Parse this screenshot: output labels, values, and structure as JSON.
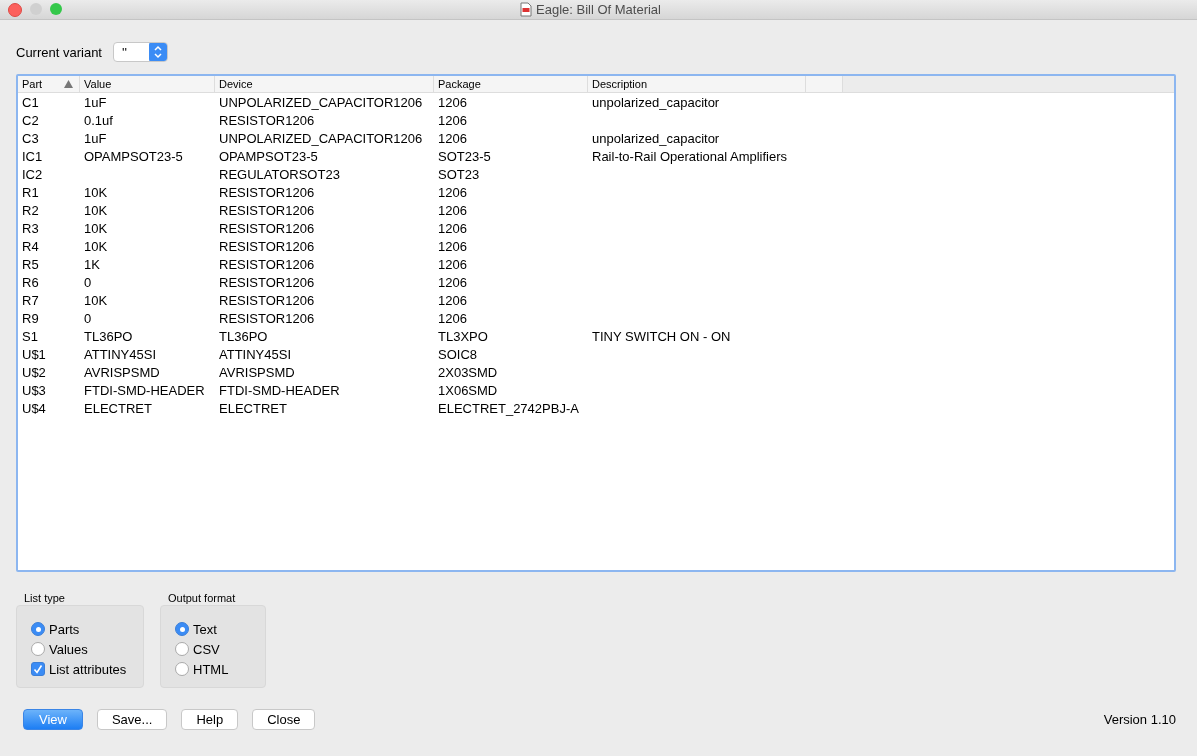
{
  "window": {
    "title": "Eagle: Bill Of Material"
  },
  "variant": {
    "label": "Current variant",
    "value": "''"
  },
  "table": {
    "columns": [
      {
        "label": "Part",
        "sorted": true
      },
      {
        "label": "Value",
        "sorted": false
      },
      {
        "label": "Device",
        "sorted": false
      },
      {
        "label": "Package",
        "sorted": false
      },
      {
        "label": "Description",
        "sorted": false
      }
    ],
    "rows": [
      {
        "part": "C1",
        "value": "1uF",
        "device": "UNPOLARIZED_CAPACITOR1206",
        "package": "1206",
        "description": "unpolarized_capacitor"
      },
      {
        "part": "C2",
        "value": "0.1uf",
        "device": "RESISTOR1206",
        "package": "1206"
      },
      {
        "part": "C3",
        "value": "1uF",
        "device": "UNPOLARIZED_CAPACITOR1206",
        "package": "1206",
        "description": "unpolarized_capacitor"
      },
      {
        "part": "IC1",
        "value": "OPAMPSOT23-5",
        "device": "OPAMPSOT23-5",
        "package": "SOT23-5",
        "description": "Rail-to-Rail Operational Amplifiers"
      },
      {
        "part": "IC2",
        "device": "REGULATORSOT23",
        "package": "SOT23"
      },
      {
        "part": "R1",
        "value": "10K",
        "device": "RESISTOR1206",
        "package": "1206"
      },
      {
        "part": "R2",
        "value": "10K",
        "device": "RESISTOR1206",
        "package": "1206"
      },
      {
        "part": "R3",
        "value": "10K",
        "device": "RESISTOR1206",
        "package": "1206"
      },
      {
        "part": "R4",
        "value": "10K",
        "device": "RESISTOR1206",
        "package": "1206"
      },
      {
        "part": "R5",
        "value": "1K",
        "device": "RESISTOR1206",
        "package": "1206"
      },
      {
        "part": "R6",
        "value": "0",
        "device": "RESISTOR1206",
        "package": "1206"
      },
      {
        "part": "R7",
        "value": "10K",
        "device": "RESISTOR1206",
        "package": "1206"
      },
      {
        "part": "R9",
        "value": "0",
        "device": "RESISTOR1206",
        "package": "1206"
      },
      {
        "part": "S1",
        "value": "TL36PO",
        "device": "TL36PO",
        "package": "TL3XPO",
        "description": "TINY SWITCH ON - ON"
      },
      {
        "part": "U$1",
        "value": "ATTINY45SI",
        "device": "ATTINY45SI",
        "package": "SOIC8"
      },
      {
        "part": "U$2",
        "value": "AVRISPSMD",
        "device": "AVRISPSMD",
        "package": "2X03SMD"
      },
      {
        "part": "U$3",
        "value": "FTDI-SMD-HEADER",
        "device": "FTDI-SMD-HEADER",
        "package": "1X06SMD"
      },
      {
        "part": "U$4",
        "value": "ELECTRET",
        "device": "ELECTRET",
        "package": "ELECTRET_2742PBJ-A"
      }
    ]
  },
  "list_type": {
    "title": "List type",
    "options": [
      {
        "label": "Parts",
        "selected": true
      },
      {
        "label": "Values",
        "selected": false
      }
    ],
    "list_attributes": {
      "label": "List attributes",
      "checked": true
    }
  },
  "output_format": {
    "title": "Output format",
    "options": [
      {
        "label": "Text",
        "selected": true
      },
      {
        "label": "CSV",
        "selected": false
      },
      {
        "label": "HTML",
        "selected": false
      }
    ]
  },
  "buttons": [
    {
      "label": "View",
      "default": true
    },
    {
      "label": "Save...",
      "default": false
    },
    {
      "label": "Help",
      "default": false
    },
    {
      "label": "Close",
      "default": false
    }
  ],
  "version": "Version 1.10"
}
